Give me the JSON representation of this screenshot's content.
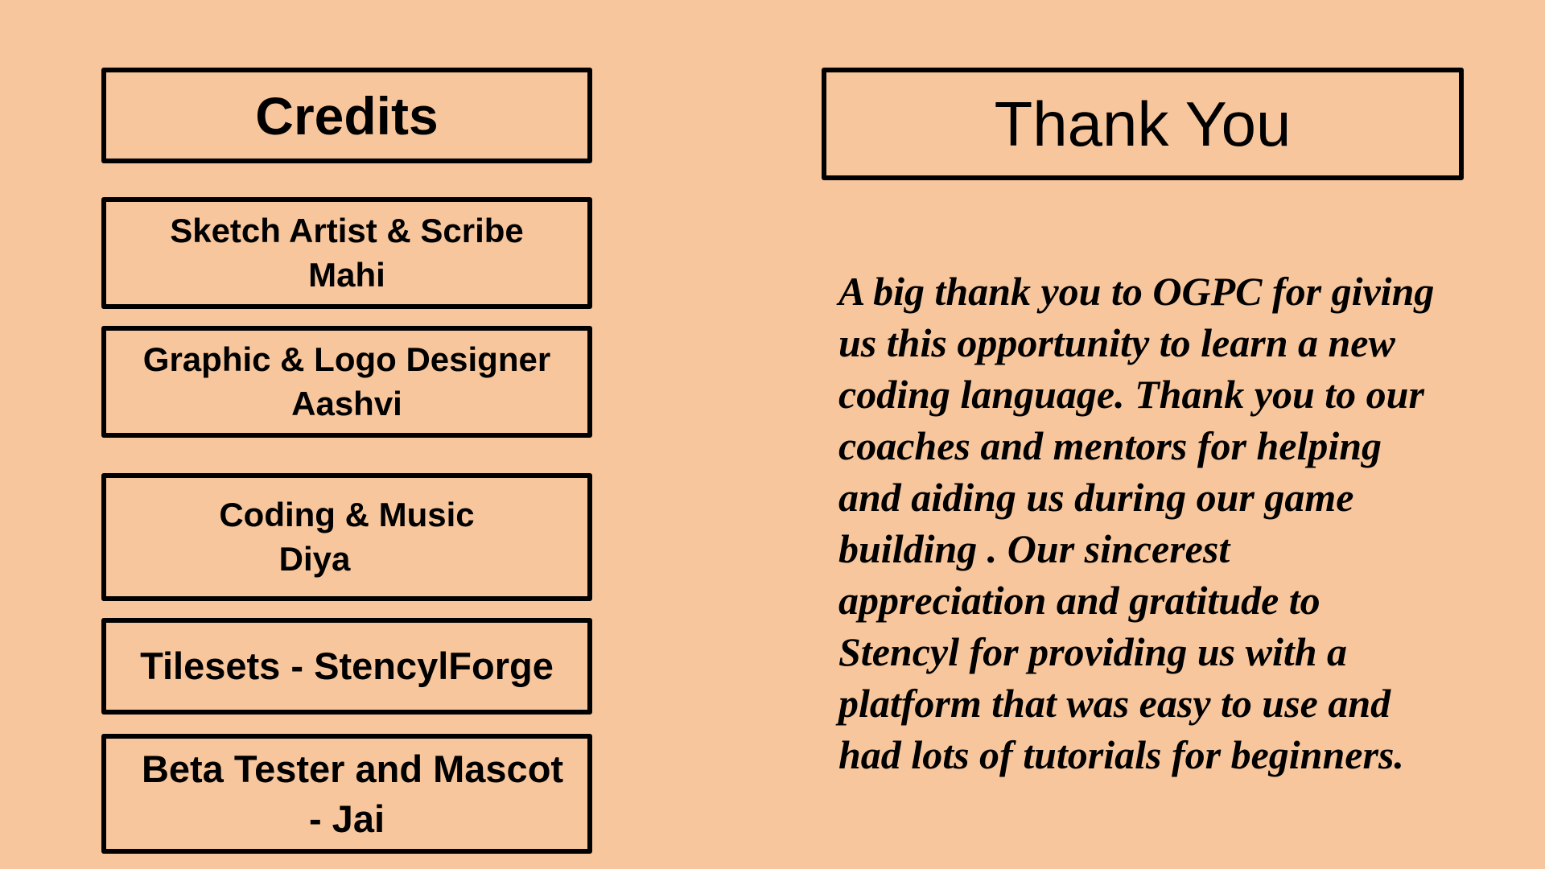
{
  "credits": {
    "title": "Credits",
    "items": [
      {
        "lines": [
          "Sketch Artist & Scribe",
          "Mahi"
        ]
      },
      {
        "lines": [
          "Graphic & Logo Designer",
          "Aashvi"
        ]
      },
      {
        "lines": [
          "Coding & Music",
          "Diya"
        ]
      },
      {
        "lines": [
          "Tilesets - StencylForge"
        ]
      },
      {
        "lines": [
          "Beta Tester and Mascot",
          "- Jai"
        ]
      }
    ]
  },
  "thanks": {
    "title": "Thank You",
    "lines": [
      "A big thank you to OGPC for giving",
      "us this opportunity to learn a new",
      "coding language. Thank you to our",
      "coaches and mentors for helping",
      "and aiding us during our game",
      "building . Our sincerest",
      "appreciation and gratitude to",
      "Stencyl for providing us with a",
      "platform that was easy to use and",
      "had lots of tutorials for beginners."
    ]
  },
  "colors": {
    "background": "#F8C69C",
    "border": "#000000",
    "text": "#000000"
  }
}
